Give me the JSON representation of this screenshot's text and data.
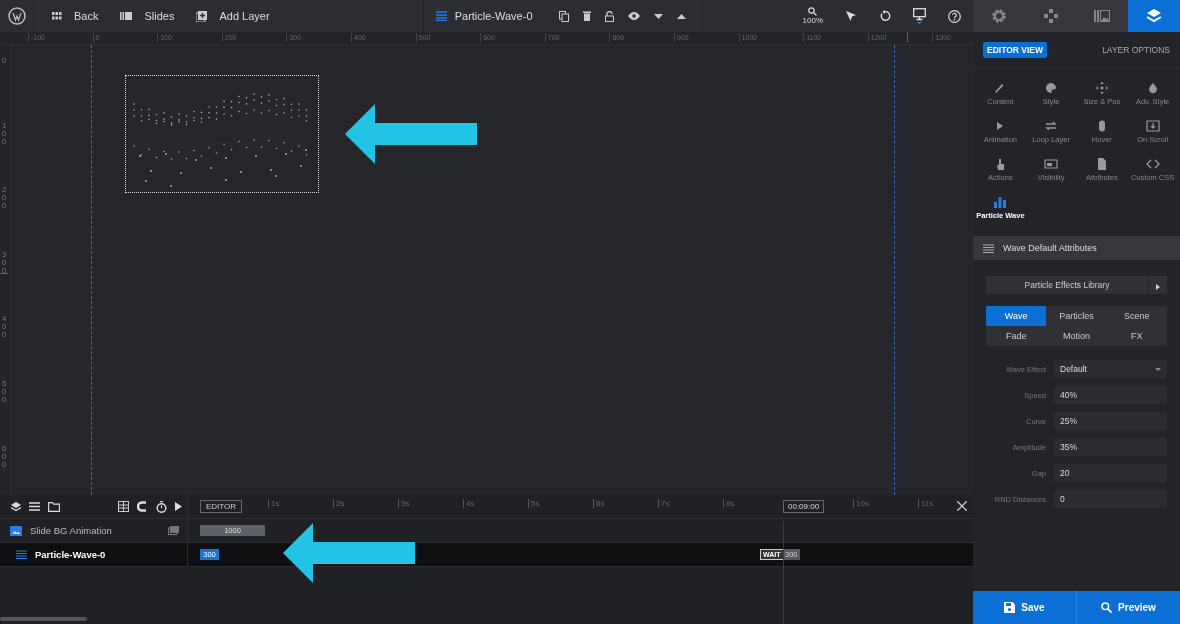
{
  "top_bar": {
    "back": "Back",
    "slides": "Slides",
    "add_layer": "Add Layer",
    "layer_name": "Particle-Wave-0",
    "zoom": "100%"
  },
  "ruler": {
    "h_labels": [
      "-100",
      "0",
      "100",
      "200",
      "300",
      "400",
      "500",
      "600",
      "700",
      "800",
      "900",
      "1000",
      "1100",
      "1200",
      "1300"
    ],
    "v_labels": [
      "0",
      "100",
      "200",
      "300",
      "400",
      "500",
      "600"
    ]
  },
  "panel_tabs": [
    {
      "kind": "settings",
      "selected": false
    },
    {
      "kind": "navigation",
      "selected": false
    },
    {
      "kind": "slides",
      "selected": false
    },
    {
      "kind": "layers",
      "selected": true
    }
  ],
  "panel_header": {
    "view_badge": "EDITOR VIEW",
    "layer_options": "LAYER OPTIONS"
  },
  "option_groups": [
    {
      "kind": "pencil",
      "label": "Content",
      "selected": false
    },
    {
      "kind": "palette",
      "label": "Style",
      "selected": false
    },
    {
      "kind": "move",
      "label": "Size & Pos",
      "selected": false
    },
    {
      "kind": "drop",
      "label": "Adv. Style",
      "selected": false
    },
    {
      "kind": "play",
      "label": "Animation",
      "selected": false
    },
    {
      "kind": "loop",
      "label": "Loop Layer",
      "selected": false
    },
    {
      "kind": "mouse",
      "label": "Hover",
      "selected": false
    },
    {
      "kind": "scroll",
      "label": "On Scroll",
      "selected": false
    },
    {
      "kind": "hand",
      "label": "Actions",
      "selected": false
    },
    {
      "kind": "screen",
      "label": "Visibility",
      "selected": false
    },
    {
      "kind": "file",
      "label": "Attributes",
      "selected": false
    },
    {
      "kind": "code",
      "label": "Custom CSS",
      "selected": false
    },
    {
      "kind": "chart",
      "label": "Particle Wave",
      "selected": true
    }
  ],
  "section": {
    "title": "Wave Default Attributes",
    "library": "Particle Effects Library",
    "effect_tabs": [
      {
        "label": "Wave",
        "selected": true
      },
      {
        "label": "Particles",
        "selected": false
      },
      {
        "label": "Scene",
        "selected": false
      },
      {
        "label": "Fade",
        "selected": false
      },
      {
        "label": "Motion",
        "selected": false
      },
      {
        "label": "FX",
        "selected": false
      }
    ],
    "fields": [
      {
        "kind": "select",
        "label": "Wave Effect",
        "value": "Default"
      },
      {
        "kind": "input",
        "label": "Speed",
        "value": "40%"
      },
      {
        "kind": "input",
        "label": "Curve",
        "value": "25%"
      },
      {
        "kind": "input",
        "label": "Amplitude",
        "value": "35%"
      },
      {
        "kind": "input",
        "label": "Gap",
        "value": "20"
      },
      {
        "kind": "input",
        "label": "RND Distances",
        "value": "0"
      }
    ]
  },
  "actions": {
    "save": "Save",
    "preview": "Preview"
  },
  "timeline": {
    "editor": "EDITOR",
    "time_marks": [
      "1s",
      "2s",
      "3s",
      "4s",
      "5s",
      "6s",
      "7s",
      "8s"
    ],
    "later_marks": [
      "10s",
      "11s"
    ],
    "current_time": "00:09:00",
    "layers": [
      {
        "kind": "slide",
        "name": "Slide BG Animation",
        "selected": false,
        "bar_label": "1000"
      },
      {
        "kind": "wave",
        "name": "Particle-Wave-0",
        "selected": true,
        "bar_label": "300",
        "wait": "WAIT",
        "end_label": "300"
      }
    ]
  }
}
